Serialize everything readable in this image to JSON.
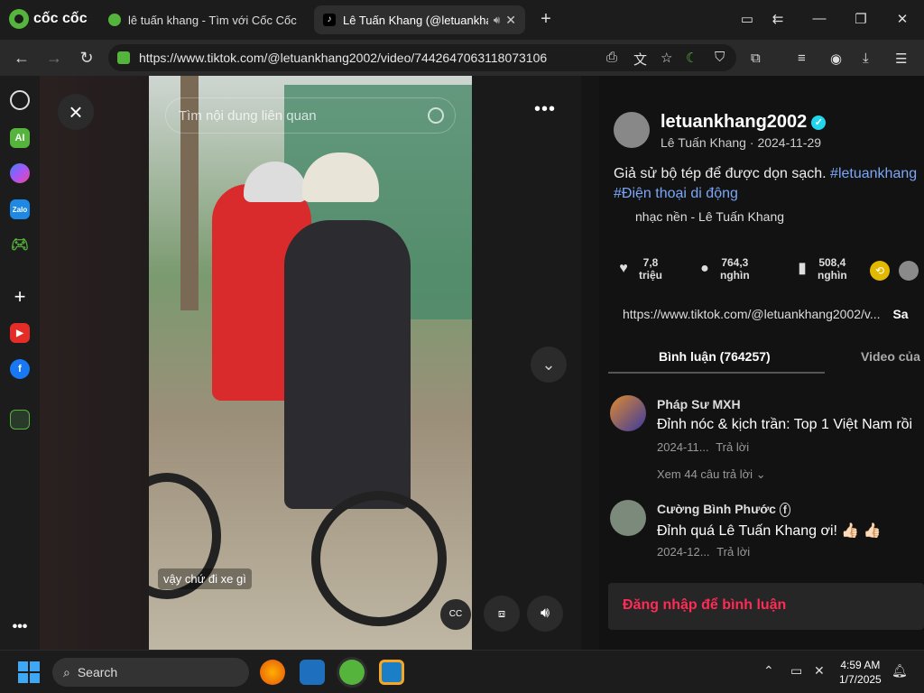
{
  "browser": {
    "name": "cốc cốc",
    "tabs": [
      {
        "title": "lê tuấn khang - Tìm với Cốc Cốc"
      },
      {
        "title": "Lê Tuấn Khang (@letuankhang"
      }
    ],
    "url": "https://www.tiktok.com/@letuankhang2002/video/7442647063118073106"
  },
  "video": {
    "search_placeholder": "Tìm nội dung liên quan",
    "caption": "vậy chứ đi xe gì"
  },
  "post": {
    "username": "letuankhang2002",
    "display_name": "Lê Tuấn Khang",
    "date": "2024-11-29",
    "description_text": "Giả sử bộ tép để được dọn sạch. ",
    "hashtag1": "#letuankhang",
    "hashtag2": "#Điện thoại di động",
    "music": "nhạc nền - Lê Tuấn Khang",
    "likes_num": "7,8",
    "likes_unit": "triệu",
    "comments_num": "764,3",
    "comments_unit": "nghìn",
    "saves_num": "508,4",
    "saves_unit": "nghìn",
    "link": "https://www.tiktok.com/@letuankhang2002/v...",
    "link_button": "Sa"
  },
  "panel_tabs": {
    "comments": "Bình luận (764257)",
    "videos": "Video của n"
  },
  "comments": [
    {
      "name": "Pháp Sư MXH",
      "text": "Đỉnh nóc & kịch trần: Top 1 Việt Nam rồi",
      "date": "2024-11...",
      "reply": "Trả lời",
      "more_replies": "Xem 44 câu trả lời"
    },
    {
      "name": "Cường Bình Phước",
      "text": "Đỉnh quá Lê Tuấn Khang ơi! 👍🏻 👍🏻",
      "date": "2024-12...",
      "reply": "Trả lời"
    }
  ],
  "login_prompt": "Đăng nhập để bình luận",
  "taskbar": {
    "search": "Search",
    "time": "4:59 AM",
    "date": "1/7/2025"
  }
}
